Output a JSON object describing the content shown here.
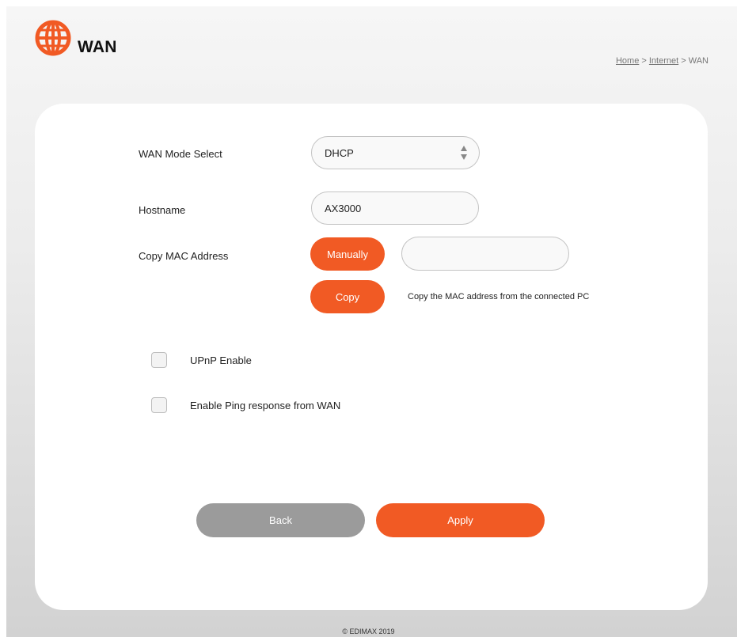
{
  "header": {
    "title": "WAN",
    "icon": "globe-icon",
    "accent": "#f15a24"
  },
  "breadcrumb": {
    "home": "Home",
    "sep1": " > ",
    "internet": "Internet",
    "sep2": " > ",
    "current": "WAN"
  },
  "form": {
    "wan_mode": {
      "label": "WAN Mode Select",
      "value": "DHCP",
      "options": [
        "DHCP"
      ]
    },
    "hostname": {
      "label": "Hostname",
      "value": "AX3000"
    },
    "copy_mac": {
      "label": "Copy MAC Address",
      "manually_label": "Manually",
      "mac_value": "",
      "copy_label": "Copy",
      "copy_hint": "Copy the MAC address from the connected PC"
    },
    "upnp": {
      "label": "UPnP Enable",
      "checked": false
    },
    "ping": {
      "label": "Enable Ping response from WAN",
      "checked": false
    }
  },
  "actions": {
    "back_label": "Back",
    "apply_label": "Apply"
  },
  "footer": {
    "copyright": "© EDIMAX 2019"
  }
}
